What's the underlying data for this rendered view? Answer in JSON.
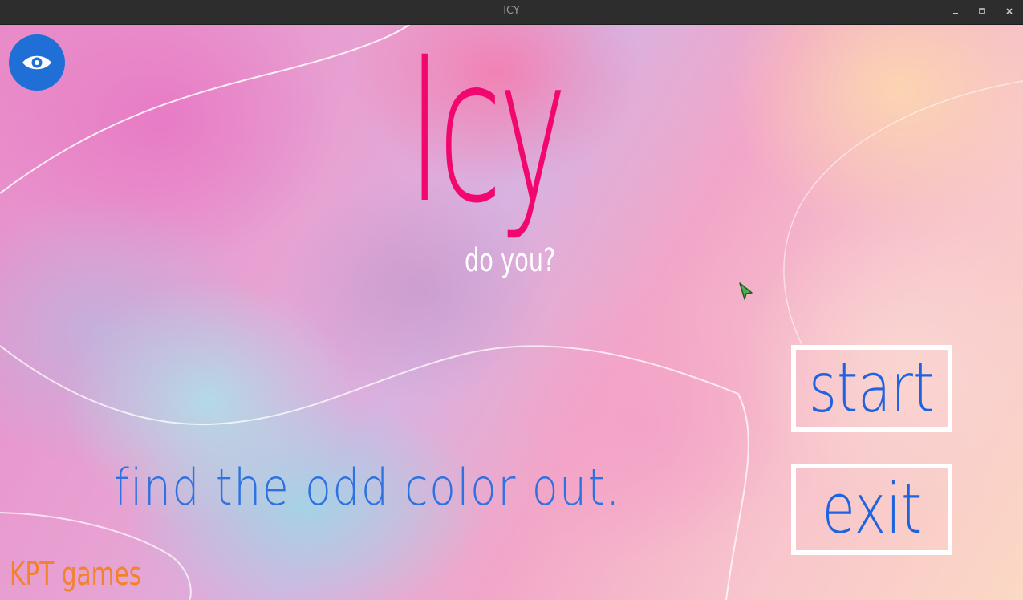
{
  "window": {
    "title": "ICY",
    "controls": {
      "minimize_icon": "minimize-icon",
      "maximize_icon": "maximize-icon",
      "close_icon": "close-icon"
    }
  },
  "game": {
    "title": "Icy",
    "subtitle": "do you?",
    "tagline": "find the odd color out.",
    "brand": "KPT games"
  },
  "menu": {
    "start_label": "start",
    "exit_label": "exit"
  },
  "icons": {
    "view_toggle": "eye-icon",
    "cursor": "pointer-cursor-icon"
  },
  "colors": {
    "title": "#f2076f",
    "subtitle": "#ffffff",
    "tagline": "#2e72e2",
    "button_text": "#1e63df",
    "button_border": "#ffffff",
    "brand": "#f2822b",
    "eye_button_bg": "#1f6fd6",
    "cursor": "#4caf50"
  }
}
